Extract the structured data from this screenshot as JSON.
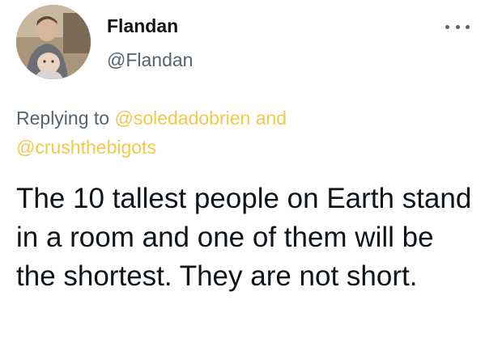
{
  "author": {
    "display_name": "Flandan",
    "handle": "@Flandan"
  },
  "more_icon": "more-horizontal-icon",
  "reply": {
    "prefix": "Replying to",
    "mention_1": "@soledadobrien",
    "conjunction": "and",
    "mention_2": "@crushthebigots"
  },
  "tweet": {
    "text": "The 10 tallest people on Earth stand in a room and one of them will be the shortest. They are not short."
  },
  "colors": {
    "mention": "#f2c84b",
    "secondary_text": "#536471",
    "primary_text": "#0f1419"
  }
}
